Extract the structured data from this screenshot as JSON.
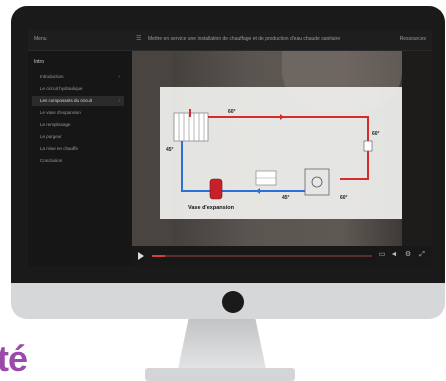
{
  "window": {
    "menu_label": "Menu",
    "course_title": "Mettre en service une installation de chauffage et de production d'eau chaude sanitaire",
    "right_label": "Ressources"
  },
  "sidebar": {
    "heading": "Intro",
    "items": [
      {
        "label": "Introduction",
        "active": false
      },
      {
        "label": "Le circuit hydraulique",
        "active": false
      },
      {
        "label": "Les composants du circuit",
        "active": true
      },
      {
        "label": "Le vase d'expansion",
        "active": false
      },
      {
        "label": "Le remplissage",
        "active": false
      },
      {
        "label": "Le purgeur",
        "active": false
      },
      {
        "label": "La mise en chauffe",
        "active": false
      },
      {
        "label": "Conclusion",
        "active": false
      }
    ]
  },
  "diagram": {
    "label_expansion": "Vase d'expansion",
    "temp_top": "60°",
    "temp_left": "45°",
    "temp_right": "60°",
    "temp_bottom_left": "45°",
    "temp_bottom_right": "60°"
  },
  "player": {
    "progress_fraction": 0.06
  },
  "brand_text": "té",
  "colors": {
    "accent": "#d3403a",
    "brand": "#9a4aa8",
    "hot_pipe": "#d62b2b",
    "cold_pipe": "#2f6fd6"
  }
}
